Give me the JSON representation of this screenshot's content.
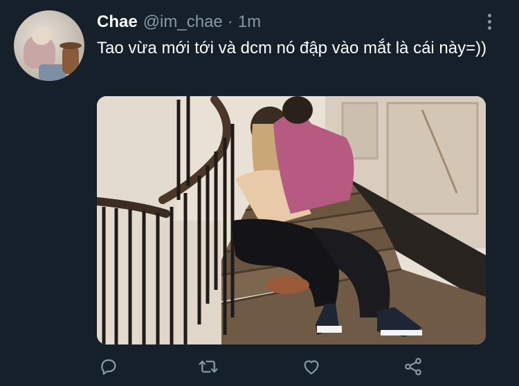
{
  "tweet": {
    "display_name": "Chae",
    "handle": "@im_chae",
    "separator": "·",
    "time": "1m",
    "text": "Tao vừa mới tới và dcm nó đập vào mắt là cái này=))"
  },
  "icons": {
    "more": "more-vertical-icon",
    "reply": "reply-icon",
    "retweet": "retweet-icon",
    "like": "heart-icon",
    "share": "share-icon"
  },
  "colors": {
    "background": "#15202b",
    "secondary_text": "#8899a6",
    "primary_text": "#ffffff"
  }
}
